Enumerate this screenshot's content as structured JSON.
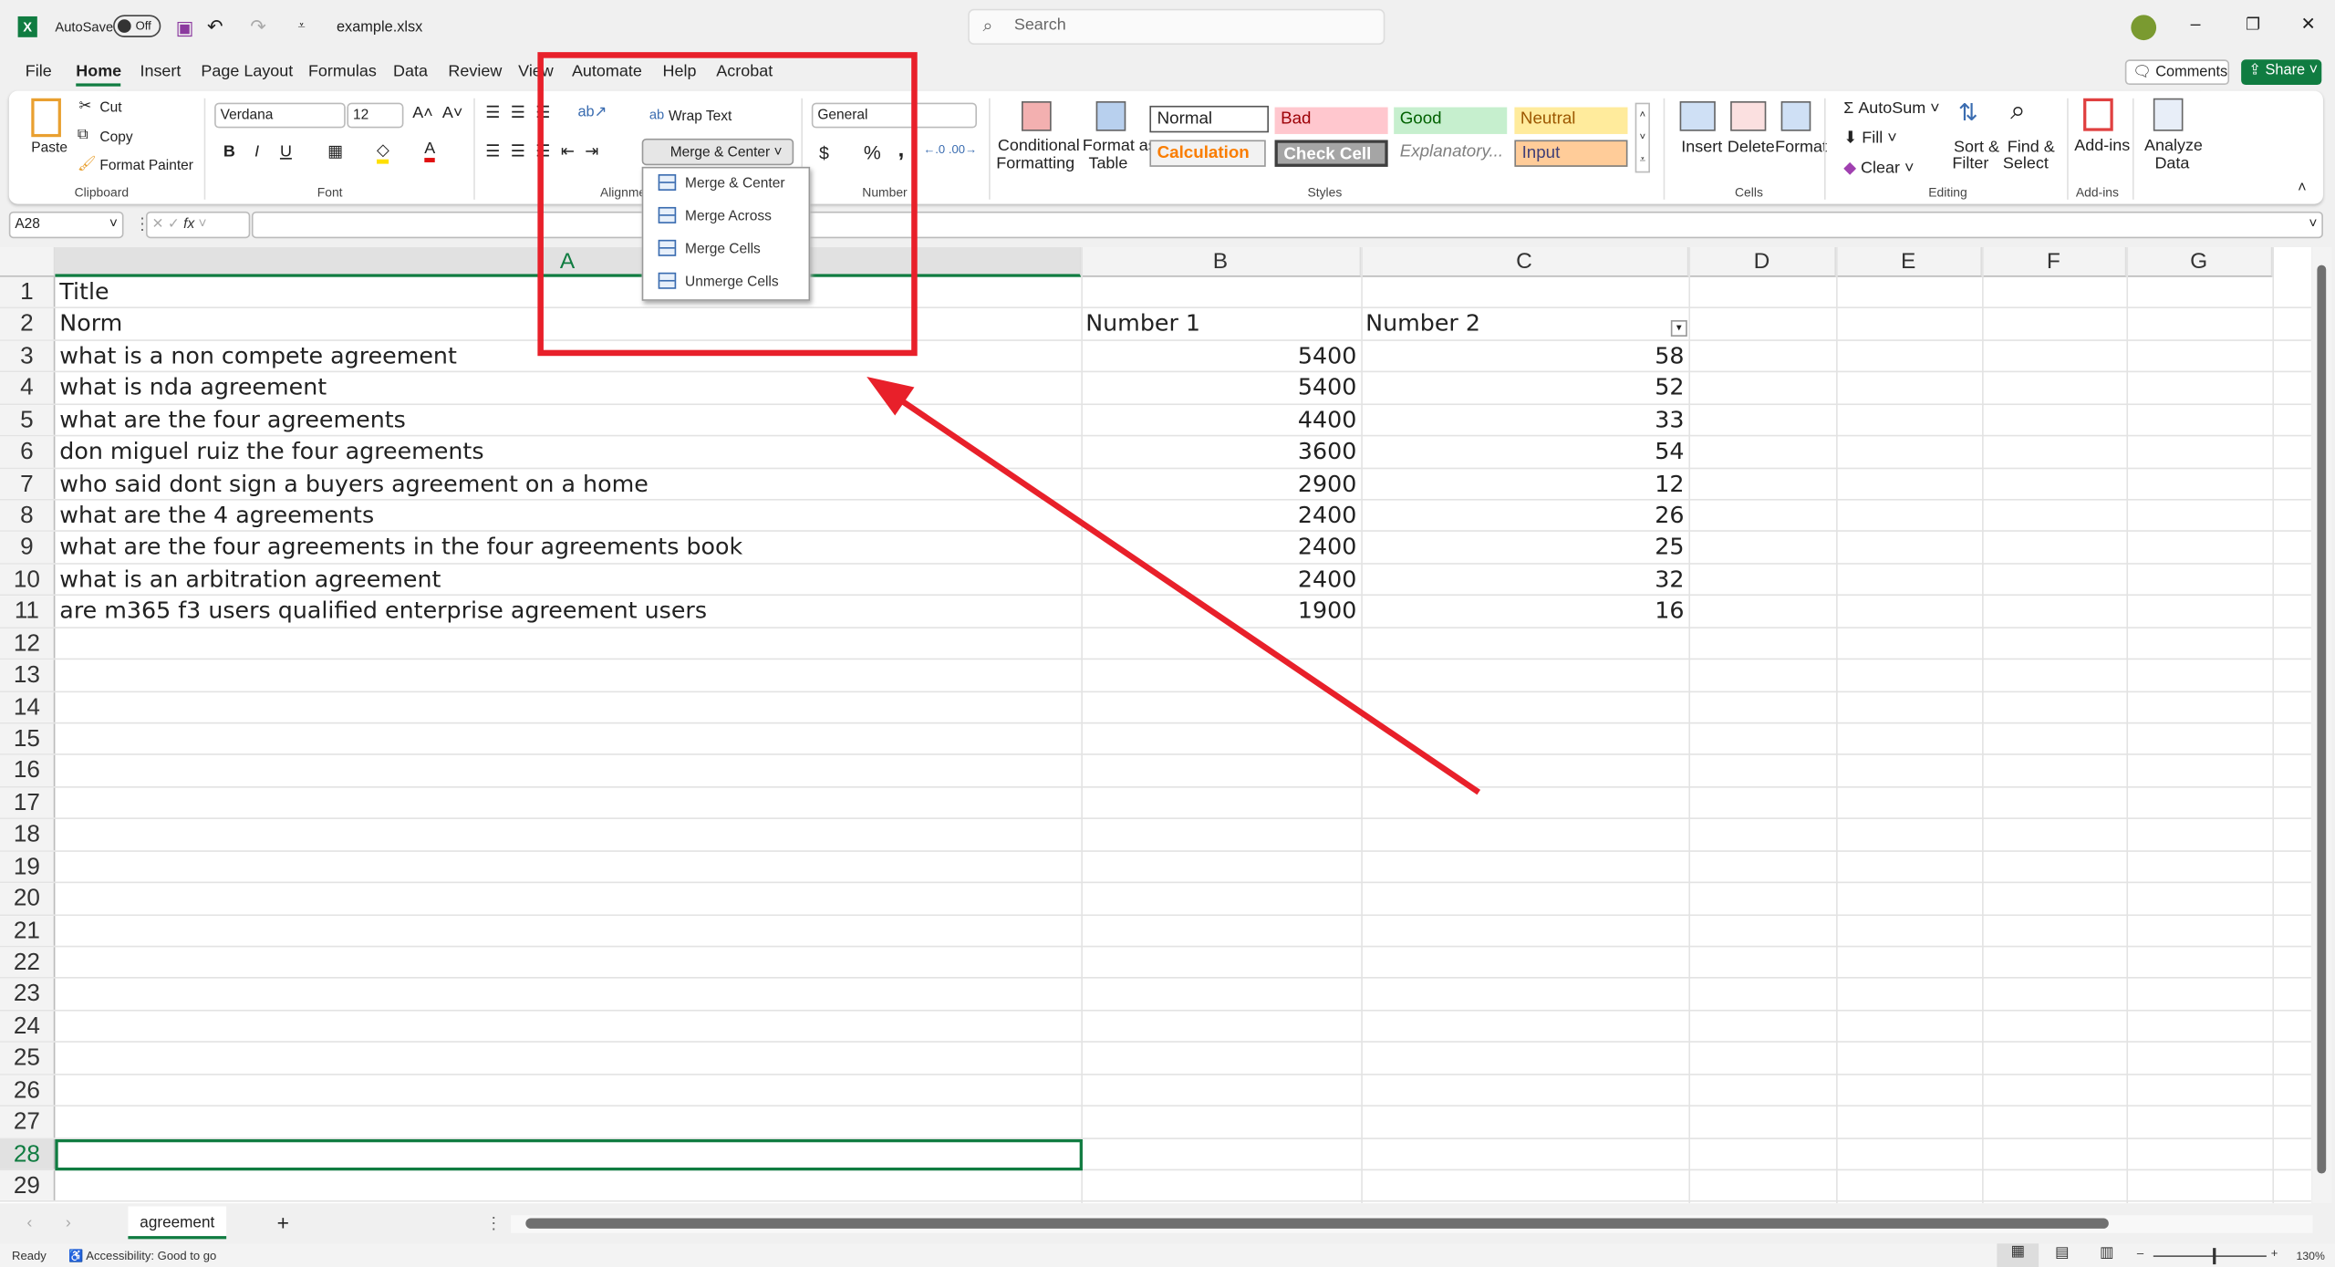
{
  "titlebar": {
    "autosave_label": "AutoSave",
    "autosave_state": "Off",
    "filename": "example.xlsx",
    "search_placeholder": "Search"
  },
  "menu": {
    "tabs": [
      "File",
      "Home",
      "Insert",
      "Page Layout",
      "Formulas",
      "Data",
      "Review",
      "View",
      "Automate",
      "Help",
      "Acrobat"
    ],
    "active": "Home",
    "comments": "Comments",
    "share": "Share"
  },
  "ribbon": {
    "clipboard": {
      "paste": "Paste",
      "cut": "Cut",
      "copy": "Copy",
      "format_painter": "Format Painter",
      "label": "Clipboard"
    },
    "font": {
      "name": "Verdana",
      "size": "12",
      "bold": "B",
      "italic": "I",
      "underline": "U",
      "label": "Font"
    },
    "alignment": {
      "wrap_text": "Wrap Text",
      "merge_center": "Merge & Center",
      "label": "Alignment"
    },
    "number": {
      "format": "General",
      "currency": "$",
      "percent": "%",
      "comma": ",",
      "label": "Number"
    },
    "styles": {
      "conditional": "Conditional",
      "formatting": "Formatting",
      "format_as": "Format as",
      "table": "Table",
      "normal": "Normal",
      "bad": "Bad",
      "good": "Good",
      "neutral": "Neutral",
      "calculation": "Calculation",
      "check_cell": "Check Cell",
      "explanatory": "Explanatory...",
      "input": "Input",
      "label": "Styles"
    },
    "cells": {
      "insert": "Insert",
      "delete": "Delete",
      "format": "Format",
      "label": "Cells"
    },
    "editing": {
      "autosum": "AutoSum",
      "fill": "Fill",
      "clear": "Clear",
      "sort": "Sort &",
      "filter": "Filter",
      "find": "Find &",
      "select": "Select",
      "label": "Editing"
    },
    "addins": {
      "addins": "Add-ins",
      "analyze": "Analyze",
      "data": "Data",
      "label": "Add-ins"
    }
  },
  "merge_menu": [
    "Merge & Center",
    "Merge Across",
    "Merge Cells",
    "Unmerge Cells"
  ],
  "formula_bar": {
    "name_box": "A28",
    "fx": "fx",
    "value": ""
  },
  "columns": [
    "A",
    "B",
    "C",
    "D",
    "E",
    "F",
    "G"
  ],
  "rows": [
    [
      "Title",
      "",
      ""
    ],
    [
      "Norm",
      "Number 1",
      "Number 2"
    ],
    [
      "what is a non compete agreement",
      "5400",
      "58"
    ],
    [
      "what is nda agreement",
      "5400",
      "52"
    ],
    [
      "what are the four agreements",
      "4400",
      "33"
    ],
    [
      "don miguel ruiz the four agreements",
      "3600",
      "54"
    ],
    [
      "who said dont sign a buyers agreement on a home",
      "2900",
      "12"
    ],
    [
      "what are the 4 agreements",
      "2400",
      "26"
    ],
    [
      "what are the four agreements in the four agreements book",
      "2400",
      "25"
    ],
    [
      "what is an arbitration agreement",
      "2400",
      "32"
    ],
    [
      "are m365 f3 users qualified enterprise agreement users",
      "1900",
      "16"
    ]
  ],
  "row_count": 29,
  "selected_cell": "A28",
  "sheet_tabs": [
    "agreement"
  ],
  "status": {
    "ready": "Ready",
    "accessibility": "Accessibility: Good to go",
    "zoom": "130%"
  },
  "colors": {
    "accent": "#107c41",
    "annotation": "#e8202a"
  }
}
